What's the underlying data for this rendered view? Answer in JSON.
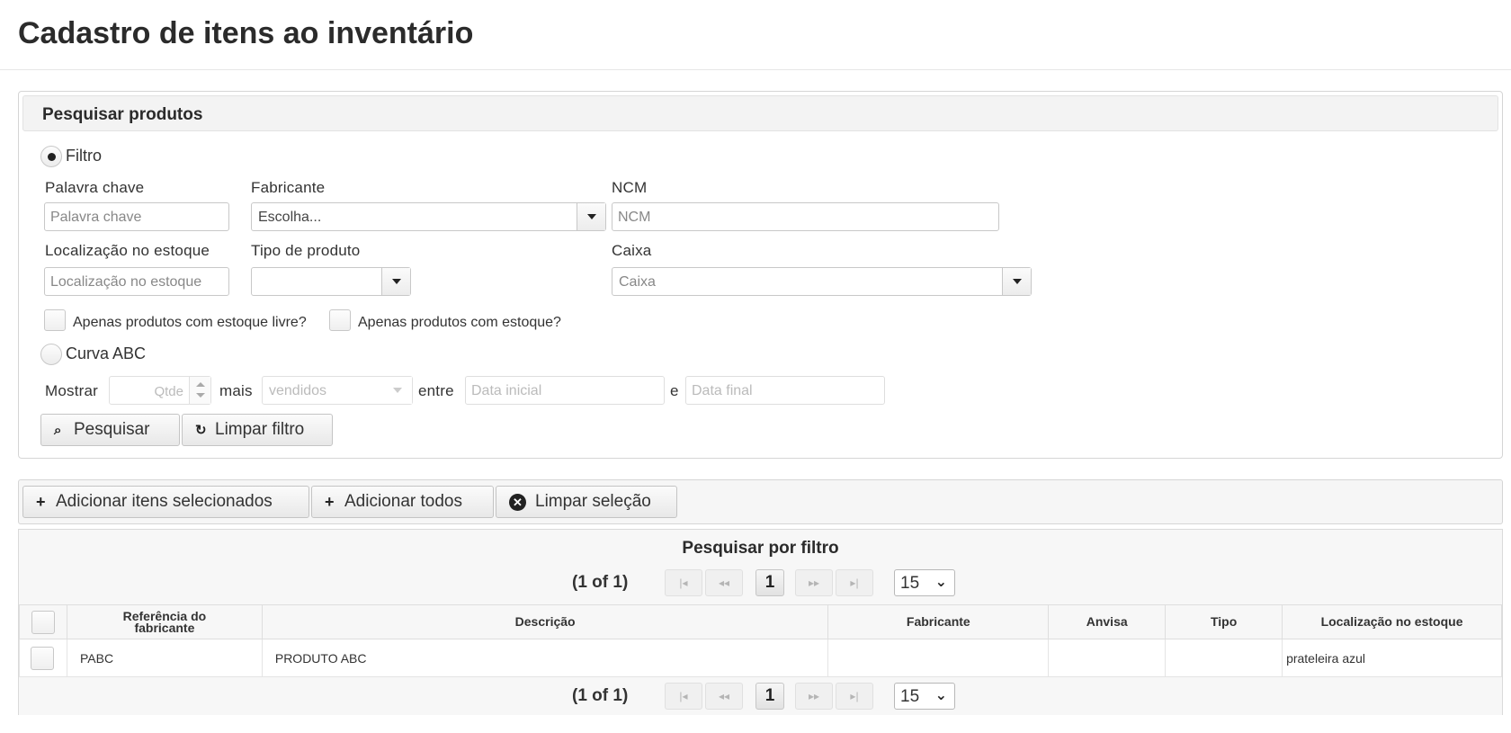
{
  "page": {
    "title": "Cadastro de itens ao inventário"
  },
  "search": {
    "title": "Pesquisar produtos",
    "filter_radio": "Filtro",
    "keyword": {
      "label": "Palavra chave",
      "placeholder": "Palavra chave"
    },
    "manufacturer": {
      "label": "Fabricante",
      "value": "Escolha..."
    },
    "ncm": {
      "label": "NCM",
      "placeholder": "NCM"
    },
    "location": {
      "label": "Localização no estoque",
      "placeholder": "Localização no estoque"
    },
    "product_type": {
      "label": "Tipo de produto",
      "value": ""
    },
    "box": {
      "label": "Caixa",
      "value": "Caixa"
    },
    "only_free_stock": "Apenas produtos com estoque livre?",
    "only_stock": "Apenas produtos com estoque?",
    "abc_radio": "Curva ABC",
    "show_label": "Mostrar",
    "qty_placeholder": "Qtde",
    "more_label": "mais",
    "sold_value": "vendidos",
    "between_label": "entre",
    "start_placeholder": "Data inicial",
    "and_label": "e",
    "end_placeholder": "Data final",
    "search_button": "Pesquisar",
    "clear_button": "Limpar filtro"
  },
  "toolbar": {
    "add_selected": "Adicionar itens selecionados",
    "add_all": "Adicionar todos",
    "clear_selection": "Limpar seleção"
  },
  "table": {
    "title": "Pesquisar por filtro",
    "page_count": "(1 of 1)",
    "current_page": "1",
    "rows_per_page": "15",
    "headers": {
      "ref_line1": "Referência do",
      "ref_line2": "fabricante",
      "description": "Descrição",
      "manufacturer": "Fabricante",
      "anvisa": "Anvisa",
      "type": "Tipo",
      "location": "Localização no estoque"
    },
    "rows": [
      {
        "ref": "PABC",
        "description": "PRODUTO ABC",
        "manufacturer": "",
        "anvisa": "",
        "type": "",
        "location": "prateleira azul"
      }
    ]
  }
}
